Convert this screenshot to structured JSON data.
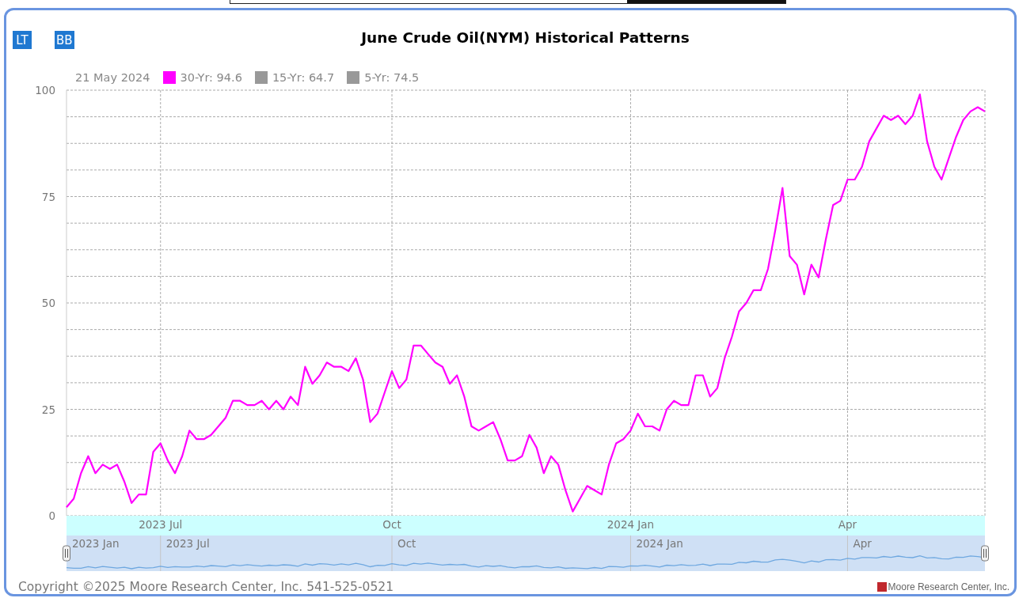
{
  "toolbar": {
    "buttons": [
      "LT",
      "BB"
    ]
  },
  "title": "June Crude Oil(NYM) Historical Patterns",
  "legend": {
    "date": "21 May 2024",
    "items": [
      {
        "label": "15-Yr: 64.7",
        "color": "#999999"
      },
      {
        "label": "5-Yr: 74.5",
        "color": "#999999"
      }
    ]
  },
  "chart": {
    "chart_data": {
      "type": "line",
      "grid": true,
      "ylim": [
        0,
        100
      ],
      "yticks": [
        0,
        25,
        50,
        75,
        100
      ],
      "categories": [
        null,
        null,
        null,
        null,
        null,
        null,
        null,
        null,
        null,
        null,
        null,
        null,
        null,
        "2023 Jul",
        null,
        null,
        null,
        null,
        null,
        null,
        null,
        null,
        null,
        null,
        null,
        null,
        null,
        null,
        null,
        null,
        null,
        null,
        null,
        null,
        null,
        null,
        null,
        null,
        null,
        null,
        null,
        null,
        null,
        null,
        null,
        "Oct",
        null,
        null,
        null,
        null,
        null,
        null,
        null,
        null,
        null,
        null,
        null,
        null,
        null,
        null,
        null,
        null,
        null,
        null,
        null,
        null,
        null,
        null,
        null,
        null,
        null,
        null,
        null,
        null,
        null,
        null,
        null,
        null,
        "2024 Jan",
        null,
        null,
        null,
        null,
        null,
        null,
        null,
        null,
        null,
        null,
        null,
        null,
        null,
        null,
        null,
        null,
        null,
        null,
        null,
        null,
        null,
        null,
        null,
        null,
        null,
        null,
        null,
        null,
        null,
        "Apr",
        null,
        null,
        null,
        null,
        null,
        null,
        null,
        null,
        null,
        null,
        null,
        null,
        null,
        null,
        null,
        null,
        null,
        null,
        null
      ],
      "series": [
        {
          "name": "30-Yr: 94.6",
          "color": "#ff00ff",
          "values": [
            2,
            4,
            10,
            14,
            10,
            12,
            11,
            12,
            8,
            3,
            5,
            5,
            15,
            17,
            13,
            10,
            14,
            20,
            18,
            18,
            19,
            21,
            23,
            27,
            27,
            26,
            26,
            27,
            25,
            27,
            25,
            28,
            26,
            35,
            31,
            33,
            36,
            35,
            35,
            34,
            37,
            32,
            22,
            24,
            29,
            34,
            30,
            32,
            40,
            40,
            38,
            36,
            35,
            31,
            33,
            28,
            21,
            20,
            21,
            22,
            18,
            13,
            13,
            14,
            19,
            16,
            10,
            14,
            12,
            6,
            1,
            4,
            7,
            6,
            5,
            12,
            17,
            18,
            20,
            24,
            21,
            21,
            20,
            25,
            27,
            26,
            26,
            33,
            33,
            28,
            30,
            37,
            42,
            48,
            50,
            53,
            53,
            58,
            67,
            77,
            61,
            59,
            52,
            59,
            56,
            65,
            73,
            74,
            79,
            79,
            82,
            88,
            91,
            94,
            93,
            94,
            92,
            94,
            99,
            88,
            82,
            79,
            84,
            89,
            93,
            95,
            96,
            95
          ]
        }
      ]
    }
  },
  "navigator": {
    "labels": [
      "2023 Jan",
      "2023 Jul",
      "Oct",
      "2024 Jan",
      "Apr"
    ]
  },
  "footer": {
    "copyright": "Copyright ©2025 Moore Research Center, Inc. 541-525-0521",
    "credit": "Moore Research Center, Inc."
  }
}
